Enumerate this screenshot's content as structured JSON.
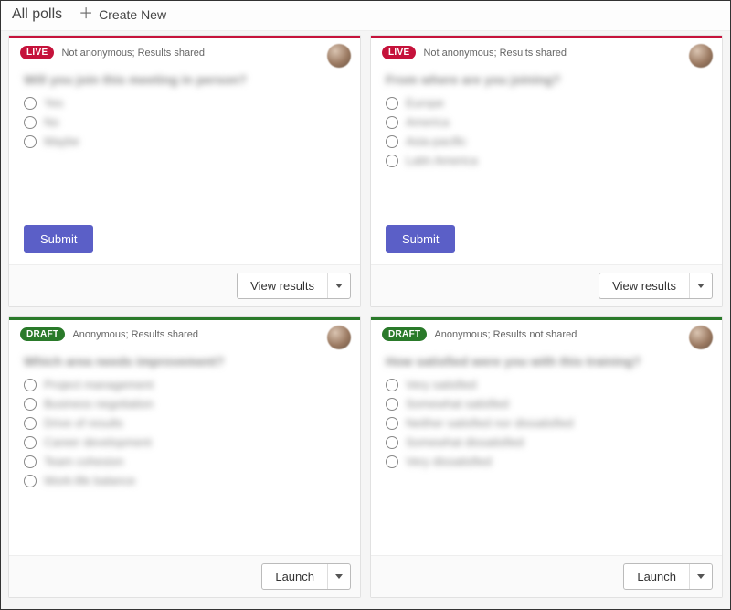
{
  "topbar": {
    "title": "All polls",
    "create_label": "Create New"
  },
  "badges": {
    "live": "LIVE",
    "draft": "DRAFT"
  },
  "polls": [
    {
      "status": "live",
      "meta": "Not anonymous; Results shared",
      "question": "Will you join this meeting in person?",
      "options": [
        "Yes",
        "No",
        "Maybe"
      ],
      "submit": "Submit",
      "footer_action": "View results"
    },
    {
      "status": "live",
      "meta": "Not anonymous; Results shared",
      "question": "From where are you joining?",
      "options": [
        "Europe",
        "America",
        "Asia-pacific",
        "Latin America"
      ],
      "submit": "Submit",
      "footer_action": "View results"
    },
    {
      "status": "draft",
      "meta": "Anonymous; Results shared",
      "question": "Which area needs improvement?",
      "options": [
        "Project management",
        "Business negotiation",
        "Drive of results",
        "Career development",
        "Team cohesion",
        "Work-life balance"
      ],
      "footer_action": "Launch"
    },
    {
      "status": "draft",
      "meta": "Anonymous; Results not shared",
      "question": "How satisfied were you with this training?",
      "options": [
        "Very satisfied",
        "Somewhat satisfied",
        "Neither satisfied nor dissatisfied",
        "Somewhat dissatisfied",
        "Very dissatisfied"
      ],
      "footer_action": "Launch"
    }
  ]
}
